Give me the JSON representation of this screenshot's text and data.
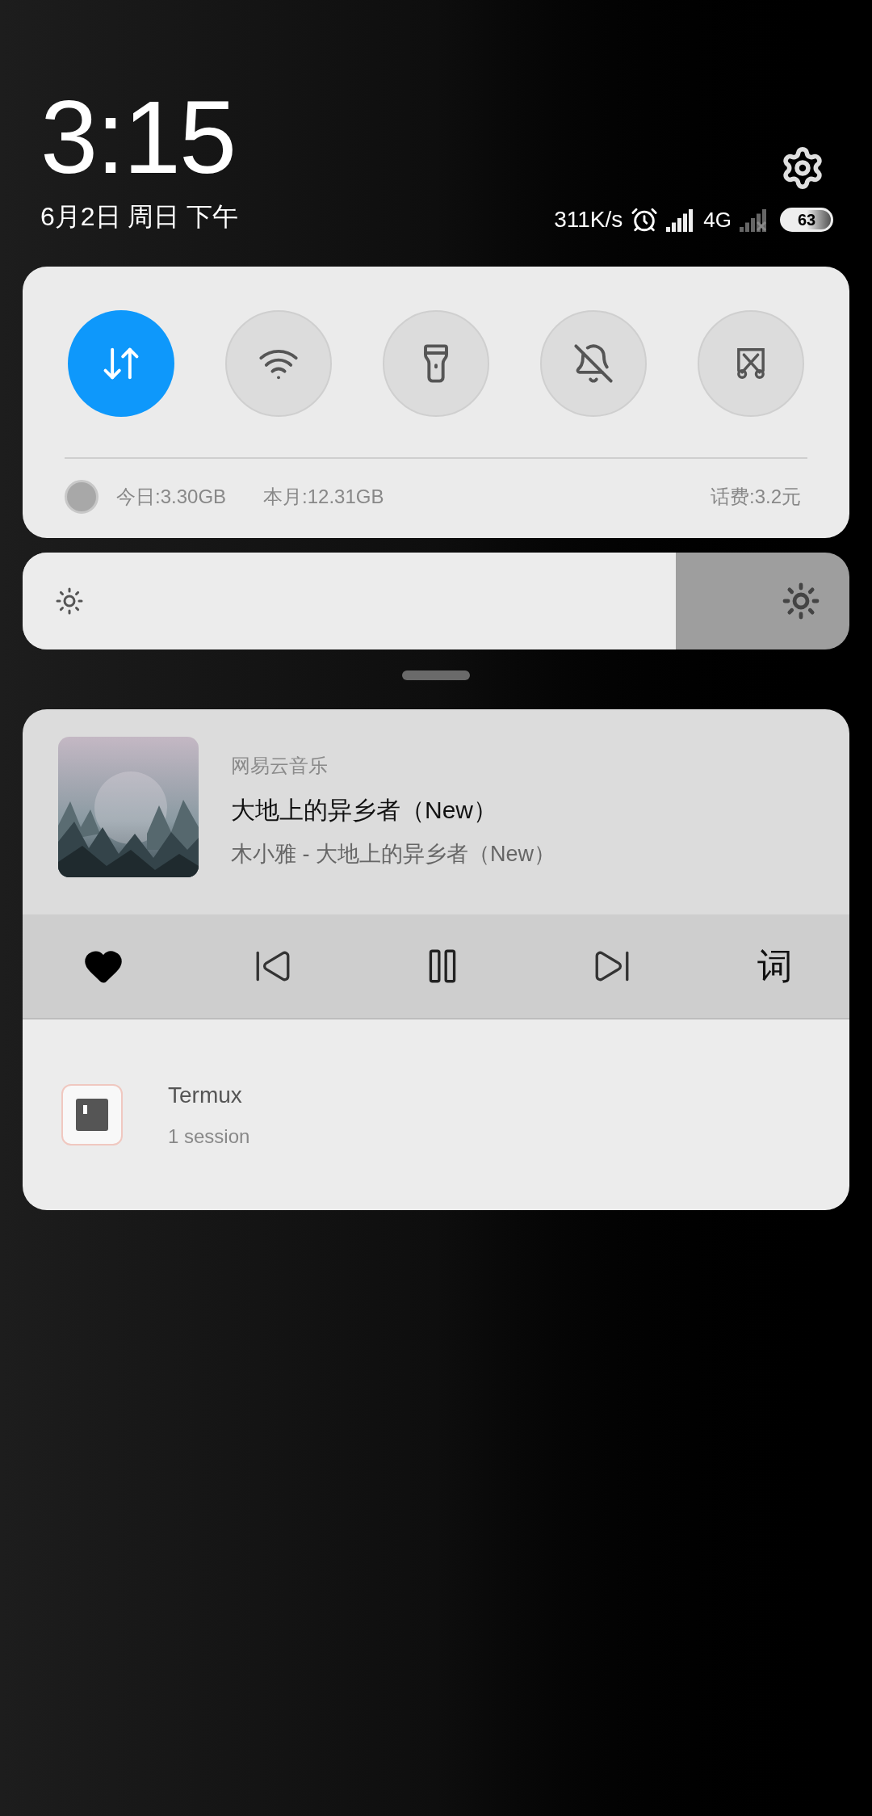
{
  "clock": {
    "time": "3:15",
    "date": "6月2日 周日 下午"
  },
  "status": {
    "speed": "311K/s",
    "network": "4G",
    "battery": "63"
  },
  "toggles": [
    {
      "kind": "data",
      "on": true
    },
    {
      "kind": "wifi",
      "on": false
    },
    {
      "kind": "flashlight",
      "on": false
    },
    {
      "kind": "mute",
      "on": false
    },
    {
      "kind": "screenshot",
      "on": false
    }
  ],
  "usage": {
    "today": "今日:3.30GB",
    "month": "本月:12.31GB",
    "fee": "话费:3.2元"
  },
  "brightness": {
    "level": 0.79
  },
  "notifications": [
    {
      "kind": "media",
      "app": "网易云音乐",
      "title": "大地上的异乡者（New）",
      "subtitle": "木小雅 - 大地上的异乡者（New）",
      "liked": true,
      "playing": true,
      "lyrics_button": "词"
    },
    {
      "kind": "app",
      "title": "Termux",
      "subtitle": "1 session"
    }
  ]
}
